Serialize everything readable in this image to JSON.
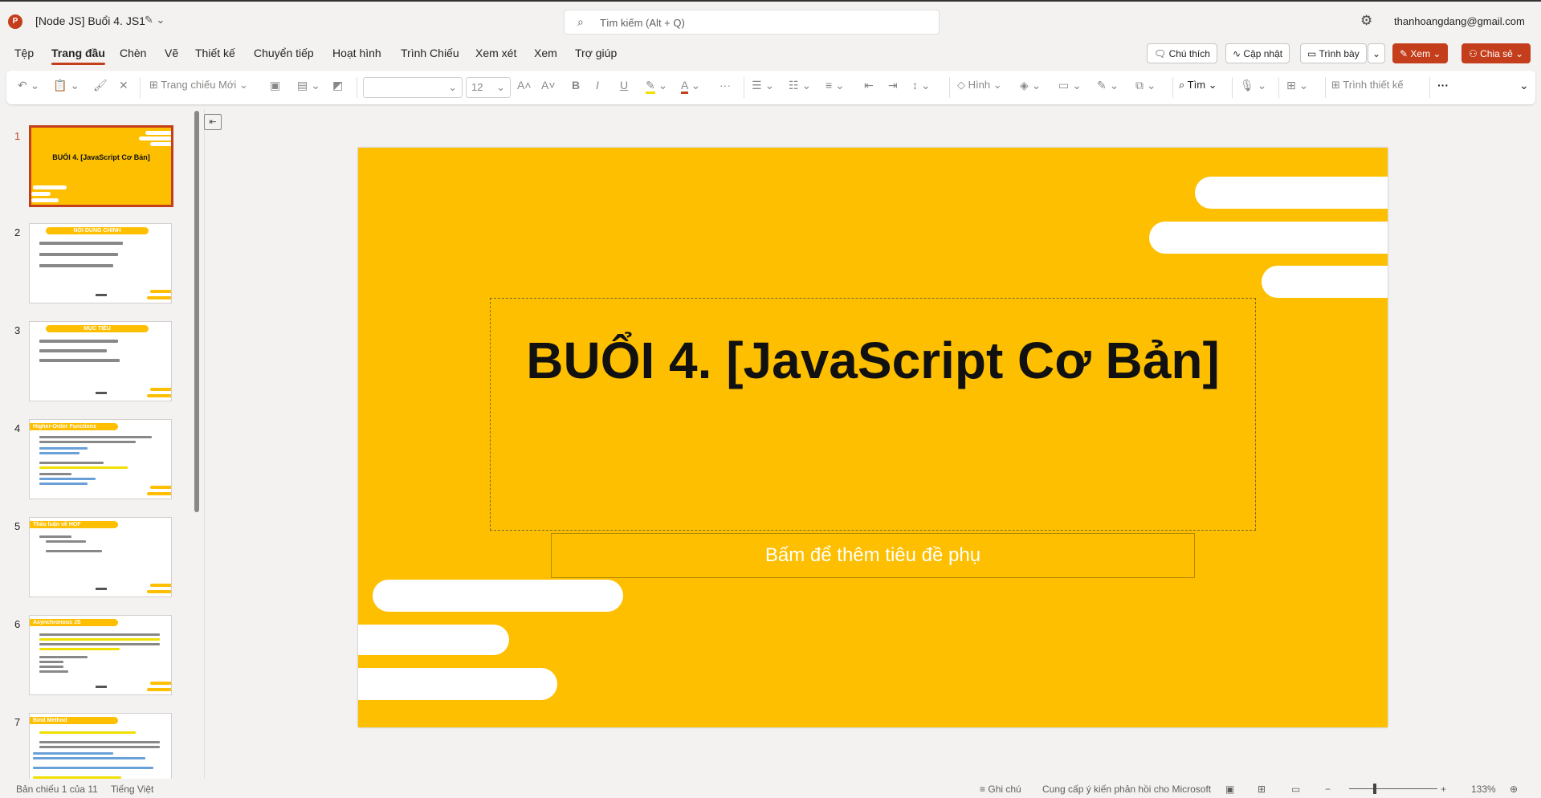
{
  "topbar": {
    "app_icon": "powerpoint-icon",
    "logo_letter": "P",
    "doc_title": "[Node JS] Buổi 4. JS1",
    "search_placeholder": "Tìm kiếm (Alt + Q)",
    "user_email": "thanhoangdang@gmail.com"
  },
  "menu": {
    "items": [
      "Tệp",
      "Trang đầu",
      "Chèn",
      "Vẽ",
      "Thiết kế",
      "Chuyển tiếp",
      "Hoạt hình",
      "Trình Chiếu",
      "Xem xét",
      "Xem",
      "Trợ giúp"
    ],
    "active_index": 1
  },
  "right_buttons": {
    "comments": "Chú thích",
    "update": "Cập nhật",
    "present": "Trình bày",
    "view": "Xem",
    "share": "Chia sẻ"
  },
  "ribbon": {
    "new_slide": "Trang chiếu Mới",
    "font_size": "12",
    "bold": "B",
    "italic": "I",
    "underline": "U",
    "font_color": "A",
    "shapes": "Hình",
    "find": "Tìm",
    "designer": "Trình thiết kế",
    "more": "···"
  },
  "thumbnails": [
    {
      "num": "1",
      "title": "BUỔI 4. [JavaScript Cơ Bản]"
    },
    {
      "num": "2",
      "title": "NỘI DUNG CHÍNH"
    },
    {
      "num": "3",
      "title": "MỤC TIÊU"
    },
    {
      "num": "4",
      "title": "Higher-Order Functions"
    },
    {
      "num": "5",
      "title": "Thảo luận về HOF"
    },
    {
      "num": "6",
      "title": "Asynchronous JS"
    },
    {
      "num": "7",
      "title": "Bind Method"
    }
  ],
  "slide": {
    "title": "BUỔI 4. [JavaScript Cơ Bản]",
    "subtitle_placeholder": "Bấm để thêm tiêu đề phụ"
  },
  "status": {
    "slide_counter": "Bản chiếu 1 của 11",
    "language": "Tiếng Việt",
    "notes": "Ghi chú",
    "feedback": "Cung cấp ý kiến phản hồi cho Microsoft",
    "zoom": "133%"
  },
  "colors": {
    "accent": "#c43e1c",
    "slide_bg": "#fdbf00"
  }
}
